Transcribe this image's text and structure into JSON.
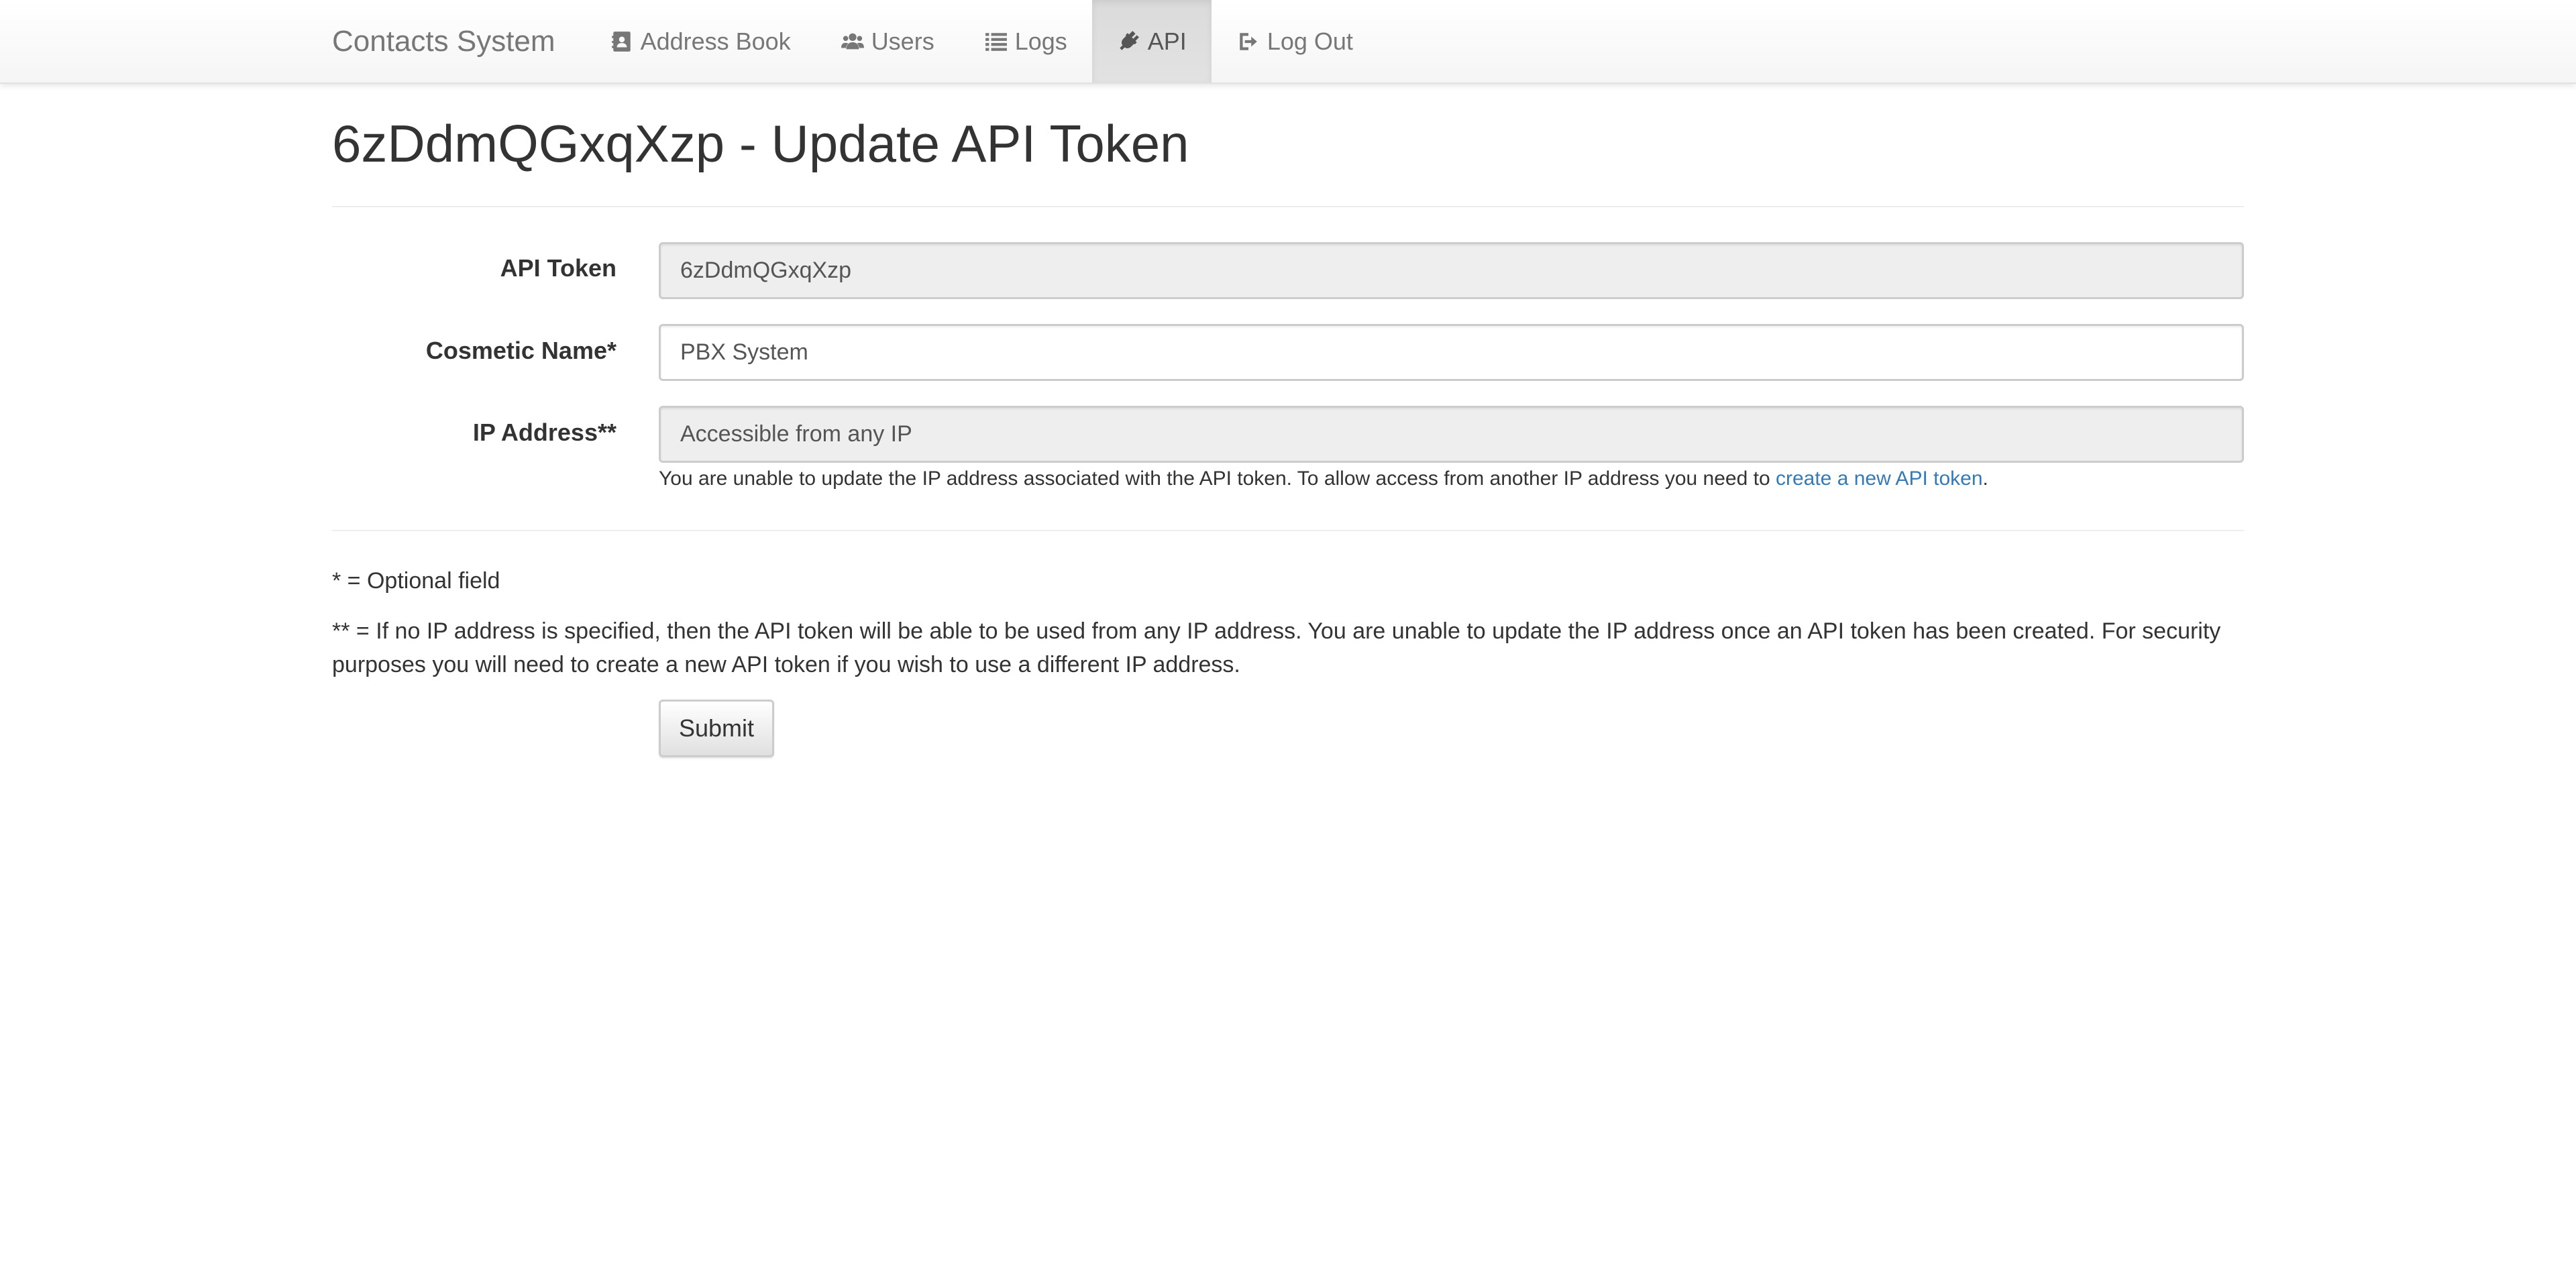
{
  "navbar": {
    "brand": "Contacts System",
    "items": [
      {
        "label": "Address Book",
        "icon": "address-book-icon",
        "active": false
      },
      {
        "label": "Users",
        "icon": "users-icon",
        "active": false
      },
      {
        "label": "Logs",
        "icon": "list-icon",
        "active": false
      },
      {
        "label": "API",
        "icon": "plug-icon",
        "active": true
      },
      {
        "label": "Log Out",
        "icon": "sign-out-icon",
        "active": false
      }
    ]
  },
  "page": {
    "title": "6zDdmQGxqXzp - Update API Token"
  },
  "form": {
    "api_token": {
      "label": "API Token",
      "value": "6zDdmQGxqXzp"
    },
    "cosmetic_name": {
      "label": "Cosmetic Name*",
      "value": "PBX System"
    },
    "ip_address": {
      "label": "IP Address**",
      "value": "Accessible from any IP",
      "help_prefix": "You are unable to update the IP address associated with the API token. To allow access from another IP address you need to ",
      "help_link": "create a new API token",
      "help_suffix": "."
    },
    "submit_label": "Submit"
  },
  "notes": {
    "optional": "* = Optional field",
    "ip_note": "** = If no IP address is specified, then the API token will be able to be used from any IP address. You are unable to update the IP address once an API token has been created. For security purposes you will need to create a new API token if you wish to use a different IP address."
  },
  "colors": {
    "link": "#337ab7",
    "text": "#333333",
    "nav_text": "#777777",
    "readonly_bg": "#eeeeee"
  }
}
